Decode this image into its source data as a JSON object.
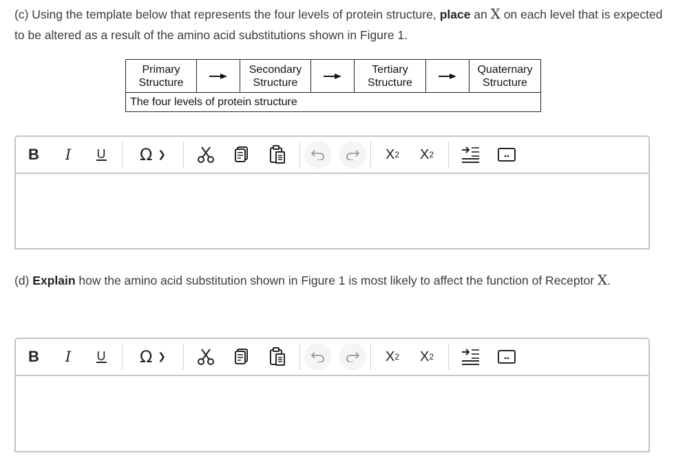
{
  "question_c": {
    "part": "(c) Using the template below that represents the four levels of protein structure,",
    "bold": "place",
    "mid": " an ",
    "x": "X",
    "rest": " on each level that is expected to be altered as a result of the amino acid substitutions shown in Figure 1."
  },
  "template": {
    "levels": [
      {
        "line1": "Primary",
        "line2": "Structure"
      },
      {
        "line1": "Secondary",
        "line2": "Structure"
      },
      {
        "line1": "Tertiary",
        "line2": "Structure"
      },
      {
        "line1": "Quaternary",
        "line2": "Structure"
      }
    ],
    "arrow_icon": "right-arrow",
    "caption": "The four levels of protein structure"
  },
  "toolbar": {
    "bold": "B",
    "italic": "I",
    "underline": "U",
    "special_chars": "Ω",
    "dropdown_glyph": "⌄",
    "cut_icon": "scissors-icon",
    "copy_icon": "copy-icon",
    "paste_icon": "paste-icon",
    "undo_icon": "undo-icon",
    "redo_icon": "redo-icon",
    "superscript_base": "X",
    "superscript_exp": "2",
    "subscript_base": "X",
    "subscript_exp": "2",
    "indent_icon": "indent-icon",
    "image_icon": "image-icon"
  },
  "question_d": {
    "part": "(d)",
    "bold": "Explain",
    "rest": " how the amino acid substitution shown in Figure 1 is most likely to affect the function of Receptor ",
    "x": "X",
    "end": "."
  },
  "editors": {
    "answer_c": "",
    "answer_d": ""
  }
}
